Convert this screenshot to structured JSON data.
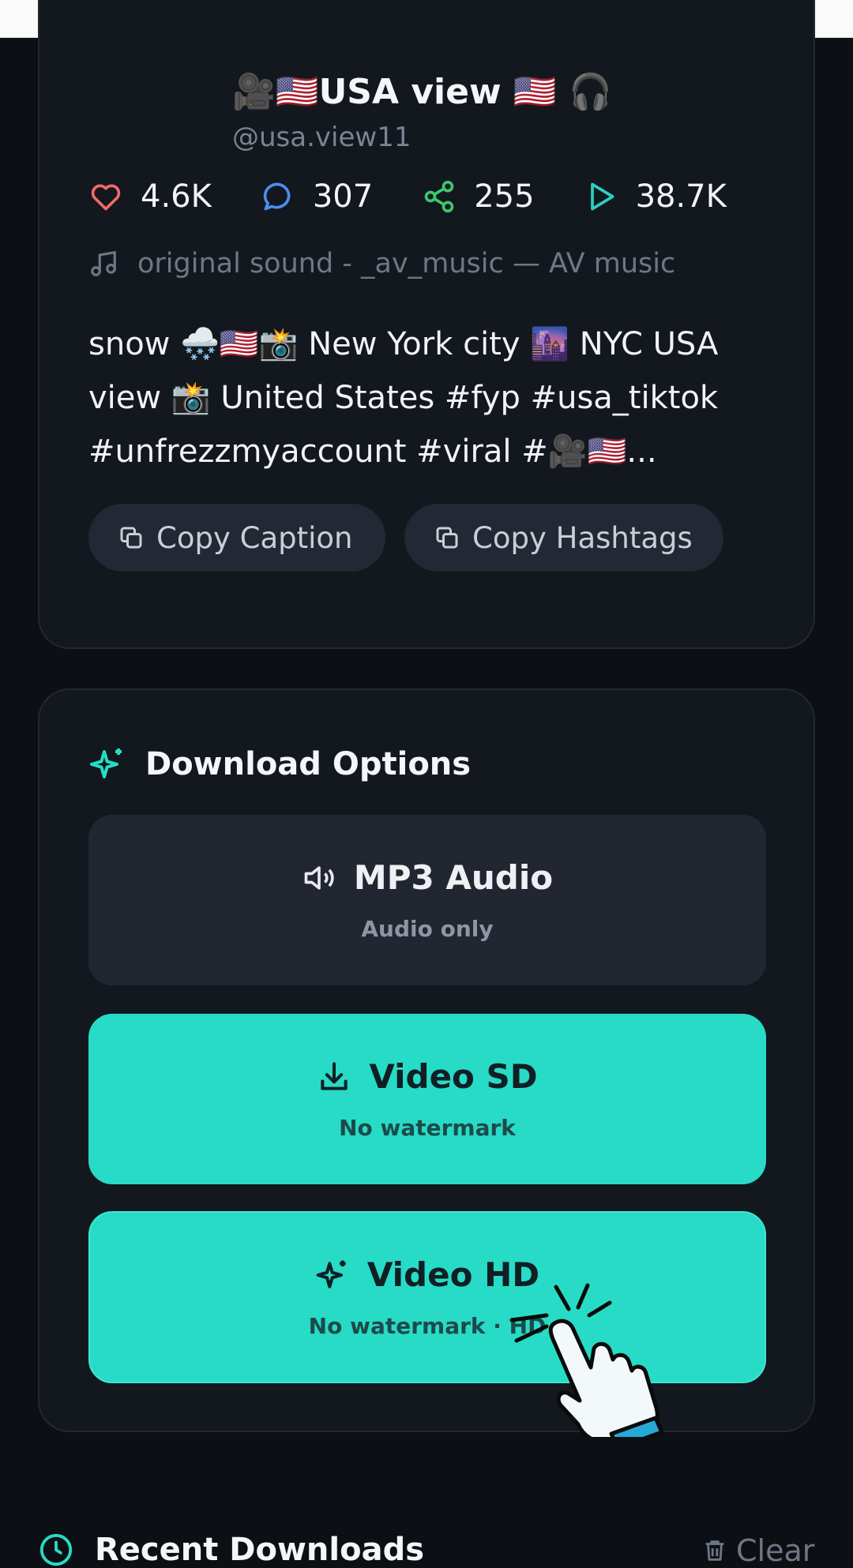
{
  "video": {
    "author_name": "🎥🇺🇸USA view 🇺🇸 🎧",
    "author_handle": "@usa.view11",
    "stats": {
      "likes": "4.6K",
      "comments": "307",
      "shares": "255",
      "views": "38.7K"
    },
    "sound": "original sound - _av_music — AV music",
    "caption": "snow 🌨️🇺🇸📸 New York city 🌆 NYC USA view 📸 United States #fyp #usa_tiktok #unfrezzmyaccount #viral #🎥🇺🇸...",
    "copy_caption_label": "Copy Caption",
    "copy_hashtags_label": "Copy Hashtags"
  },
  "download_options": {
    "title": "Download Options",
    "options": [
      {
        "title": "MP3 Audio",
        "subtitle": "Audio only"
      },
      {
        "title": "Video SD",
        "subtitle": "No watermark"
      },
      {
        "title": "Video HD",
        "subtitle": "No watermark · HD"
      }
    ]
  },
  "recent": {
    "title": "Recent Downloads",
    "clear_label": "Clear"
  },
  "colors": {
    "accent": "#27dbc6",
    "background": "#0c0f14",
    "card": "#13171e",
    "like": "#ef6a6a",
    "comment": "#4a8ef0",
    "share": "#3cc86a",
    "play": "#2ad1c0"
  },
  "icons": {
    "likes": "heart-icon",
    "comments": "comment-icon",
    "shares": "share-icon",
    "views": "play-icon",
    "sound": "music-note-icon",
    "copy": "copy-icon",
    "options_title": "sparkle-icon",
    "mp3": "speaker-icon",
    "sd": "download-icon",
    "hd": "sparkle-icon",
    "recent": "clock-icon",
    "clear": "trash-icon",
    "pointer": "pointing-hand-icon"
  }
}
